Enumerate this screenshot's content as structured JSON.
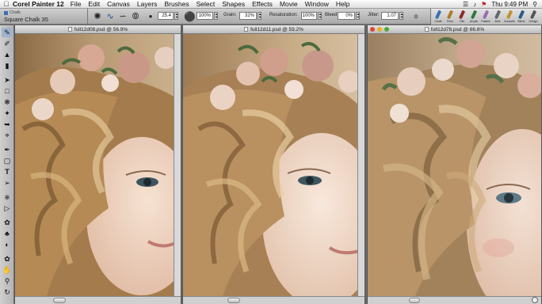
{
  "menubar": {
    "app_name": "Corel Painter 12",
    "items": [
      "File",
      "Edit",
      "Canvas",
      "Layers",
      "Brushes",
      "Select",
      "Shapes",
      "Effects",
      "Movie",
      "Window",
      "Help"
    ],
    "clock": "Thu 9:49 PM"
  },
  "brush_selector": {
    "category": "Chalk",
    "variant": "Square Chalk 35"
  },
  "property_bar": {
    "size_value": "25.4",
    "opacity_value": "100%",
    "grain_label": "Grain:",
    "grain_value": "32%",
    "resaturation_label": "Resaturation:",
    "resaturation_value": "100%",
    "bleed_label": "Bleed:",
    "bleed_value": "0%",
    "jitter_label": "Jitter:",
    "jitter_value": "1.07"
  },
  "brush_library": {
    "items": [
      {
        "name": "Chalk",
        "color": "#3d6fb5"
      },
      {
        "name": "Pens",
        "color": "#b07a2e"
      },
      {
        "name": "Oils",
        "color": "#8e2b2b"
      },
      {
        "name": "Acrylic",
        "color": "#2f7a3a"
      },
      {
        "name": "Pastels",
        "color": "#9a6bb0"
      },
      {
        "name": "Airbr",
        "color": "#666666"
      },
      {
        "name": "Gouache",
        "color": "#c09030"
      },
      {
        "name": "Blend",
        "color": "#2a5a8a"
      },
      {
        "name": "Design",
        "color": "#555555"
      }
    ]
  },
  "documents": [
    {
      "title": "full12d08.psd @ 56.9%"
    },
    {
      "title": "full12d11.psd @ 59.2%"
    },
    {
      "title": "full12d76.psd @ 66.6%"
    }
  ],
  "colors": {
    "window_close": "#e0443a",
    "window_min": "#e8b020",
    "window_zoom": "#4caa3a"
  }
}
